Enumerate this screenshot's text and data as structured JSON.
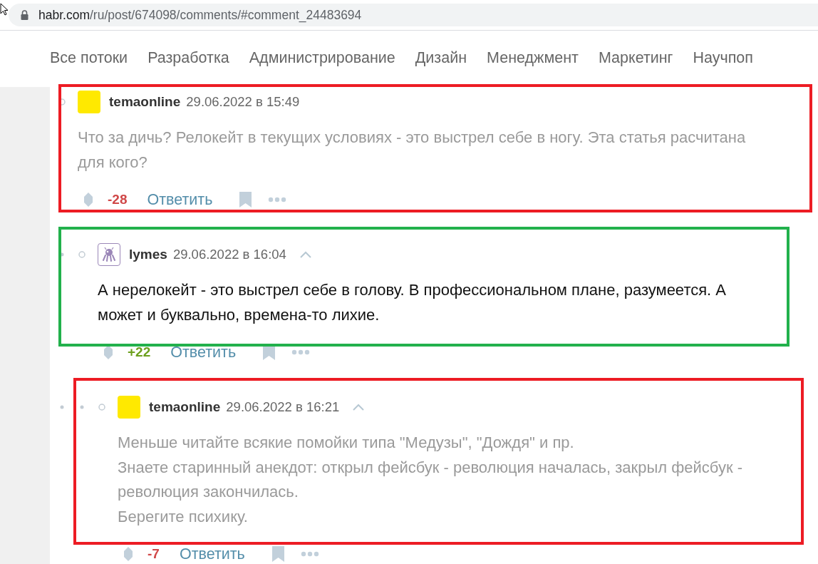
{
  "address_bar": {
    "host": "habr.com",
    "path": "/ru/post/674098/comments/#comment_24483694"
  },
  "nav": [
    {
      "label": "Все потоки"
    },
    {
      "label": "Разработка"
    },
    {
      "label": "Администрирование"
    },
    {
      "label": "Дизайн"
    },
    {
      "label": "Менеджмент"
    },
    {
      "label": "Маркетинг"
    },
    {
      "label": "Научпоп"
    }
  ],
  "comments": [
    {
      "author": "temaonline",
      "avatar": {
        "kind": "plain",
        "color": "#ffe900"
      },
      "date": "29.06.2022 в 15:49",
      "parent_link": false,
      "muted": true,
      "text": "Что за дичь? Релокейт в текущих условиях - это выстрел себе в ногу. Эта статья расчитана для кого?",
      "score": "-28",
      "color": "#d04848",
      "reply": "Ответить",
      "frame": {
        "color": "#ed1c24"
      },
      "children": [
        {
          "author": "lymes",
          "avatar": {
            "kind": "robot",
            "color": "#9b87b8"
          },
          "date": "29.06.2022 в 16:04",
          "parent_link": true,
          "muted": false,
          "text": "А нерелокейт - это выстрел себе в голову. В профессиональном плане, разумеется. А может и буквально, времена-то лихие.",
          "score": "+22",
          "color": "#6c9f1d",
          "reply": "Ответить",
          "frame": {
            "color": "#22b14c"
          },
          "children": [
            {
              "author": "temaonline",
              "avatar": {
                "kind": "plain",
                "color": "#ffe900"
              },
              "date": "29.06.2022 в 16:21",
              "parent_link": true,
              "muted": true,
              "text": "Меньше читайте всякие помойки типа \"Медузы\", \"Дождя\" и пр.\nЗнаете старинный анекдот: открыл фейсбук - революция началась, закрыл фейсбук - революция закончилась.\nБерегите психику.",
              "score": "-7",
              "color": "#d04848",
              "reply": "Ответить",
              "frame": {
                "color": "#ed1c24"
              }
            }
          ]
        }
      ]
    }
  ]
}
